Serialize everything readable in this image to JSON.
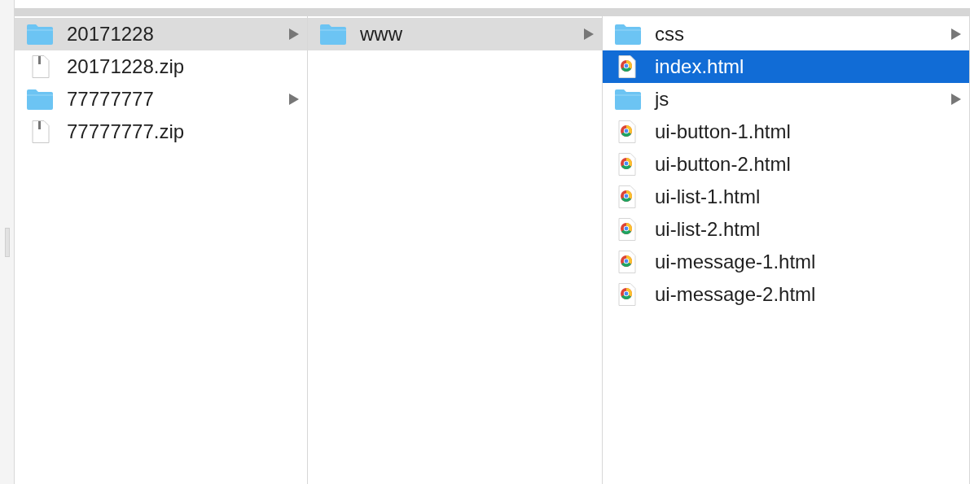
{
  "columns": [
    {
      "items": [
        {
          "name": "20171228",
          "kind": "folder",
          "selected": true
        },
        {
          "name": "20171228.zip",
          "kind": "zip",
          "selected": false
        },
        {
          "name": "77777777",
          "kind": "folder",
          "selected": false
        },
        {
          "name": "77777777.zip",
          "kind": "zip",
          "selected": false
        }
      ]
    },
    {
      "items": [
        {
          "name": "www",
          "kind": "folder",
          "selected": true
        }
      ]
    },
    {
      "items": [
        {
          "name": "css",
          "kind": "folder",
          "selected": false
        },
        {
          "name": "index.html",
          "kind": "html",
          "selected": true
        },
        {
          "name": "js",
          "kind": "folder",
          "selected": false
        },
        {
          "name": "ui-button-1.html",
          "kind": "html",
          "selected": false
        },
        {
          "name": "ui-button-2.html",
          "kind": "html",
          "selected": false
        },
        {
          "name": "ui-list-1.html",
          "kind": "html",
          "selected": false
        },
        {
          "name": "ui-list-2.html",
          "kind": "html",
          "selected": false
        },
        {
          "name": "ui-message-1.html",
          "kind": "html",
          "selected": false
        },
        {
          "name": "ui-message-2.html",
          "kind": "html",
          "selected": false
        }
      ]
    }
  ]
}
